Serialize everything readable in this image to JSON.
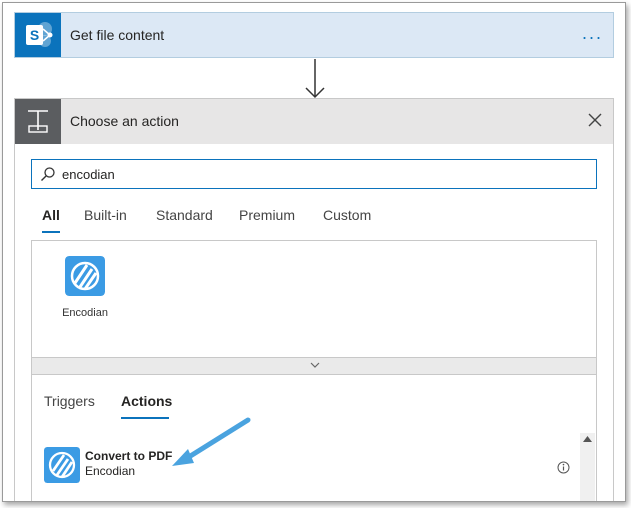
{
  "trigger_card": {
    "title": "Get file content",
    "icon": "sharepoint-icon",
    "more_label": "..."
  },
  "action_card": {
    "title": "Choose an action",
    "icon": "action-icon"
  },
  "search": {
    "value": "encodian",
    "placeholder": ""
  },
  "tabs": [
    {
      "label": "All",
      "active": true
    },
    {
      "label": "Built-in",
      "active": false
    },
    {
      "label": "Standard",
      "active": false
    },
    {
      "label": "Premium",
      "active": false
    },
    {
      "label": "Custom",
      "active": false
    }
  ],
  "connectors": [
    {
      "name": "Encodian",
      "icon": "encodian-icon"
    }
  ],
  "subtabs": [
    {
      "label": "Triggers",
      "active": false
    },
    {
      "label": "Actions",
      "active": true
    }
  ],
  "actions": [
    {
      "name": "Convert to PDF",
      "connector": "Encodian",
      "icon": "encodian-icon"
    }
  ],
  "colors": {
    "accent": "#0b73bc",
    "encodian": "#3b9be4",
    "arrow": "#4aa3df"
  }
}
